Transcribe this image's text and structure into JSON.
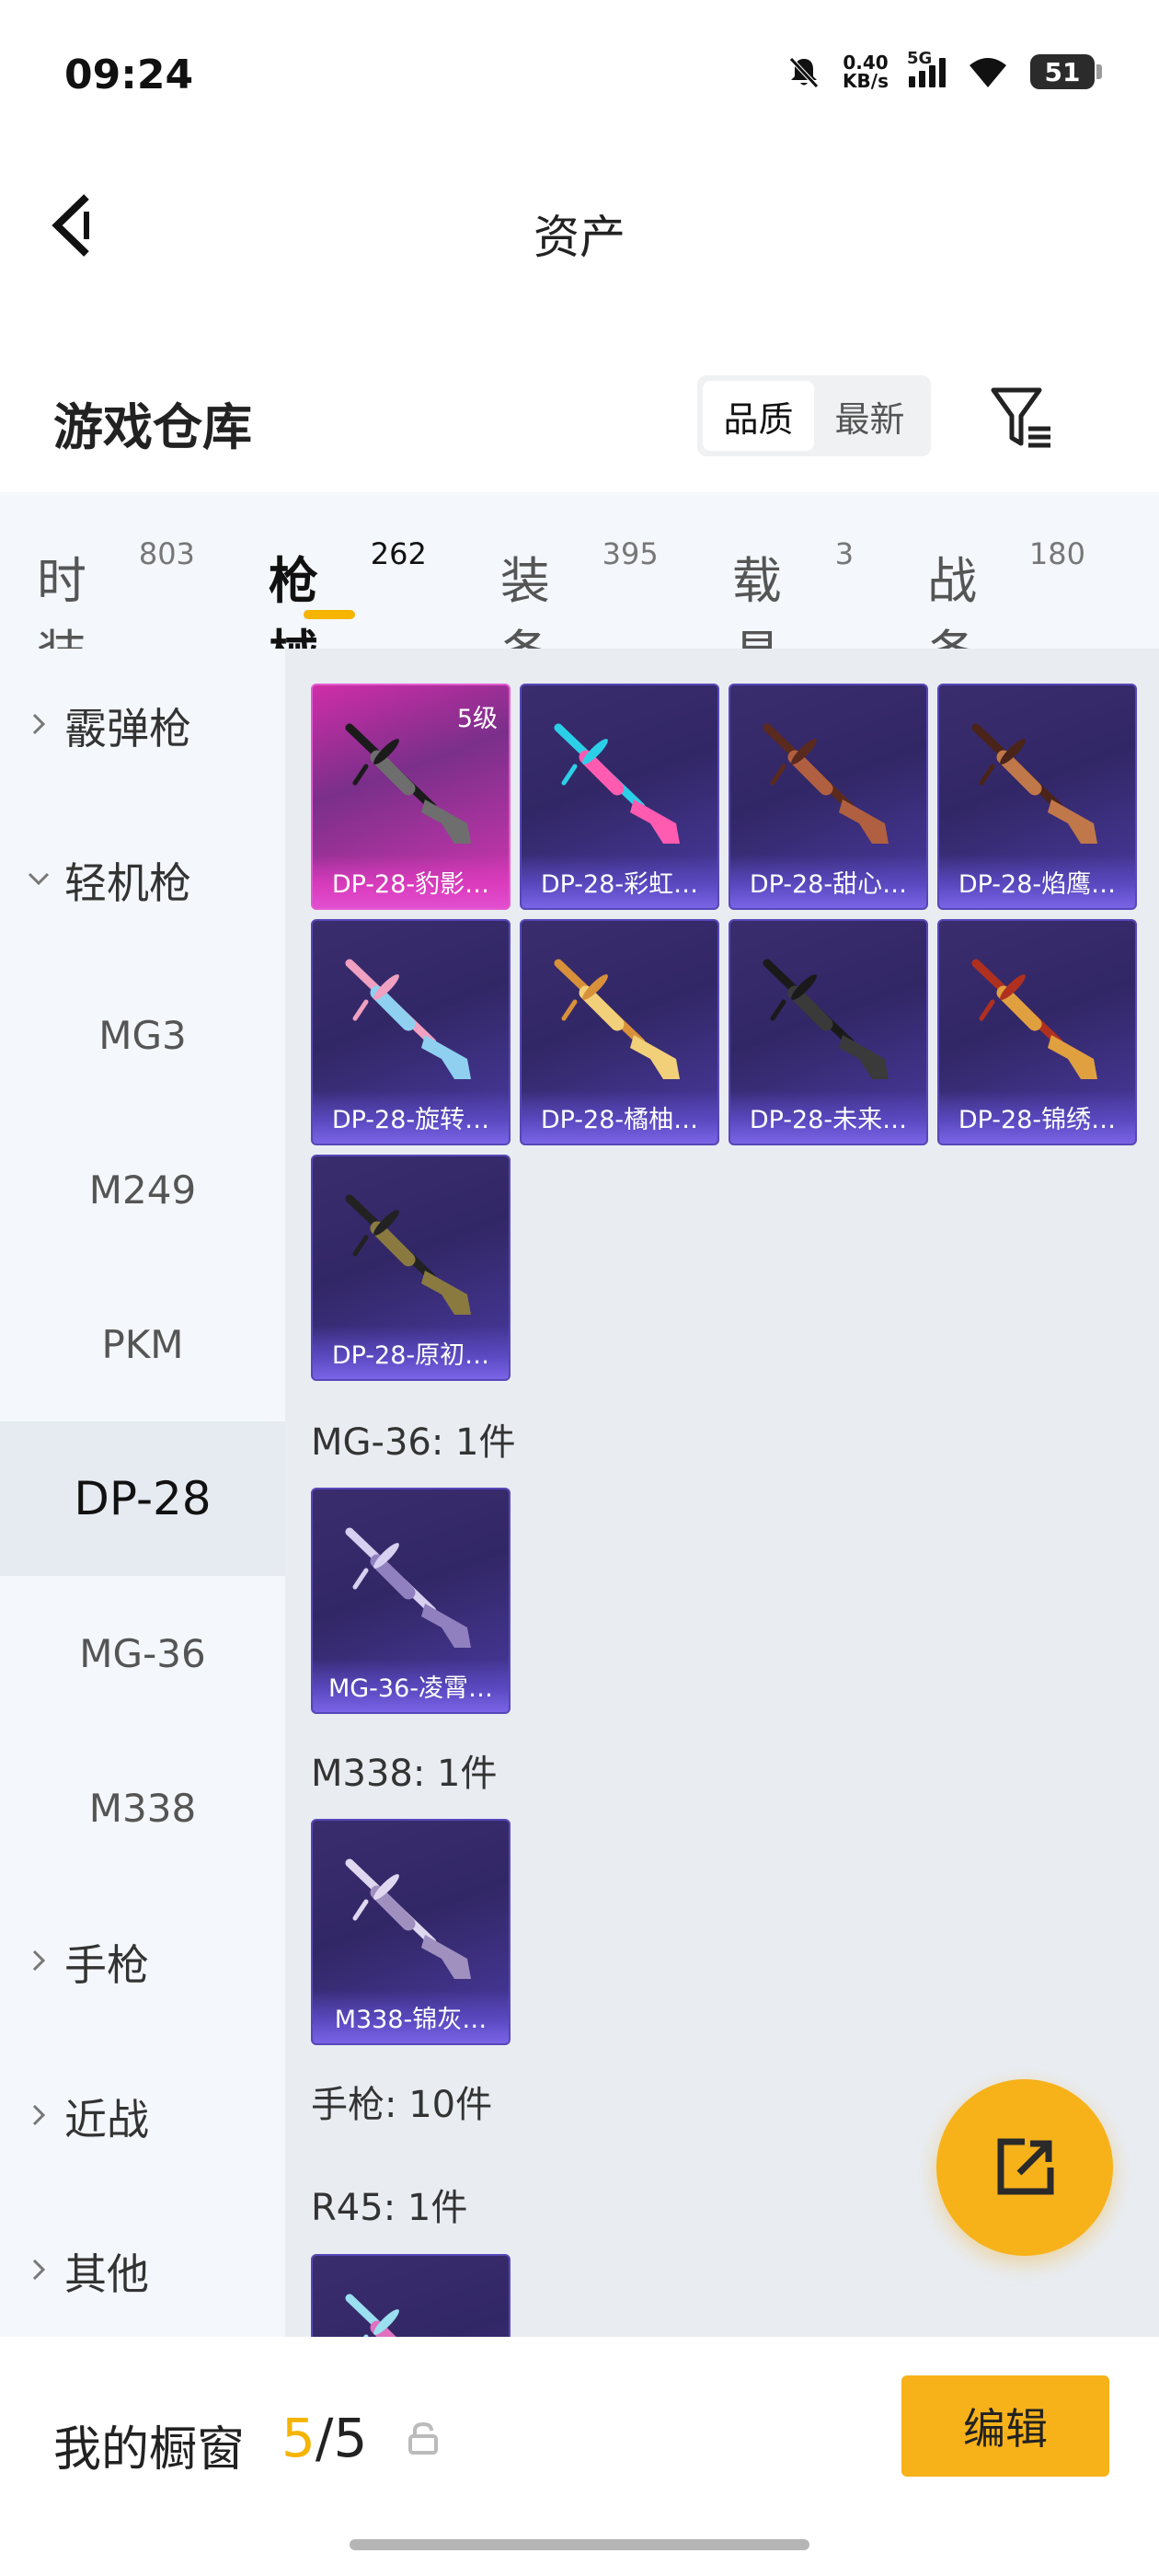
{
  "status": {
    "time": "09:24",
    "net_speed_value": "0.40",
    "net_speed_unit": "KB/s",
    "network": "5G",
    "battery": "51"
  },
  "nav": {
    "title": "资产"
  },
  "section": {
    "title": "游戏仓库",
    "sort_options": [
      "品质",
      "最新"
    ],
    "sort_active": "品质"
  },
  "tabs": [
    {
      "label": "时装",
      "count": "803"
    },
    {
      "label": "枪械",
      "count": "262"
    },
    {
      "label": "装备",
      "count": "395"
    },
    {
      "label": "载具",
      "count": "3"
    },
    {
      "label": "战备",
      "count": "180"
    }
  ],
  "sidebar": {
    "items": [
      {
        "label": "霰弹枪"
      },
      {
        "label": "轻机枪"
      },
      {
        "label": "MG3"
      },
      {
        "label": "M249"
      },
      {
        "label": "PKM"
      },
      {
        "label": "DP-28"
      },
      {
        "label": "MG-36"
      },
      {
        "label": "M338"
      },
      {
        "label": "手枪"
      },
      {
        "label": "近战"
      },
      {
        "label": "其他"
      }
    ]
  },
  "items": {
    "dp28": [
      {
        "name": "DP-28-豹影…",
        "level": "5级",
        "colors": [
          "#1b1b1b",
          "#6e6e6e"
        ]
      },
      {
        "name": "DP-28-彩虹…",
        "colors": [
          "#2bd0e8",
          "#ff5bb0"
        ]
      },
      {
        "name": "DP-28-甜心…",
        "colors": [
          "#5a2a1e",
          "#b06040"
        ]
      },
      {
        "name": "DP-28-焰鹰…",
        "colors": [
          "#4a2418",
          "#c0784a"
        ]
      },
      {
        "name": "DP-28-旋转…",
        "colors": [
          "#f0a0c0",
          "#8fd0f0"
        ]
      },
      {
        "name": "DP-28-橘柚…",
        "colors": [
          "#d8903a",
          "#f2d07a"
        ]
      },
      {
        "name": "DP-28-未来…",
        "colors": [
          "#1a1a1a",
          "#3a3a3a"
        ]
      },
      {
        "name": "DP-28-锦绣…",
        "colors": [
          "#b03020",
          "#e0a040"
        ]
      },
      {
        "name": "DP-28-原初…",
        "colors": [
          "#222222",
          "#8a7a40"
        ]
      }
    ],
    "mg36_title": "MG-36: 1件",
    "mg36": [
      {
        "name": "MG-36-凌霄…",
        "colors": [
          "#d8d0f0",
          "#9080c0"
        ]
      }
    ],
    "m338_title": "M338: 1件",
    "m338": [
      {
        "name": "M338-锦灰…",
        "colors": [
          "#e0d8f0",
          "#a090c0"
        ]
      }
    ],
    "pistol_title": "手枪: 10件",
    "r45_title": "R45: 1件",
    "r45": [
      {
        "name": "",
        "colors": [
          "#9be0f0",
          "#e070c0"
        ]
      }
    ]
  },
  "bottom": {
    "showcase_label": "我的橱窗",
    "showcase_current": "5",
    "showcase_total": "/5",
    "edit_label": "编辑"
  },
  "colors": {
    "accent": "#f5b400",
    "card_purple": "#3a2d6e",
    "card_gold": "#cf2ea8"
  }
}
